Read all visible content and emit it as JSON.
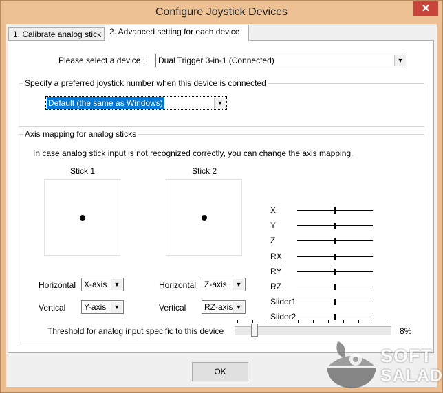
{
  "window": {
    "title": "Configure Joystick Devices",
    "close_label": "✕"
  },
  "tabs": [
    {
      "label": "1. Calibrate analog stick",
      "active": false
    },
    {
      "label": "2. Advanced setting for each device",
      "active": true
    }
  ],
  "device": {
    "label": "Please select a device :",
    "selected": "Dual Trigger 3-in-1 (Connected)"
  },
  "preferred": {
    "group_label": "Specify a preferred joystick number when this device is connected",
    "selected": "Default (the same as Windows)"
  },
  "axis_mapping": {
    "group_label": "Axis mapping for analog sticks",
    "description": "In case analog stick input is not recognized correctly, you can change the axis mapping.",
    "stick1": {
      "title": "Stick 1",
      "horizontal_label": "Horizontal",
      "horizontal_value": "X-axis",
      "vertical_label": "Vertical",
      "vertical_value": "Y-axis"
    },
    "stick2": {
      "title": "Stick 2",
      "horizontal_label": "Horizontal",
      "horizontal_value": "Z-axis",
      "vertical_label": "Vertical",
      "vertical_value": "RZ-axis"
    },
    "axes": [
      {
        "label": "X",
        "level": 0.5
      },
      {
        "label": "Y",
        "level": 0.5
      },
      {
        "label": "Z",
        "level": 0.5
      },
      {
        "label": "RX",
        "level": 0.5
      },
      {
        "label": "RY",
        "level": 0.5
      },
      {
        "label": "RZ",
        "level": 0.5
      },
      {
        "label": "Slider1",
        "level": 0.5
      },
      {
        "label": "Slider2",
        "level": 0.5
      }
    ]
  },
  "threshold": {
    "label": "Threshold for analog input specific to this device",
    "value_text": "8%",
    "value": 8
  },
  "ok_label": "OK",
  "watermark": {
    "line1": "SOFT",
    "line2": "SALAD"
  },
  "colors": {
    "frame": "#ecbf92",
    "close": "#c7443b",
    "selection": "#0078d7"
  }
}
